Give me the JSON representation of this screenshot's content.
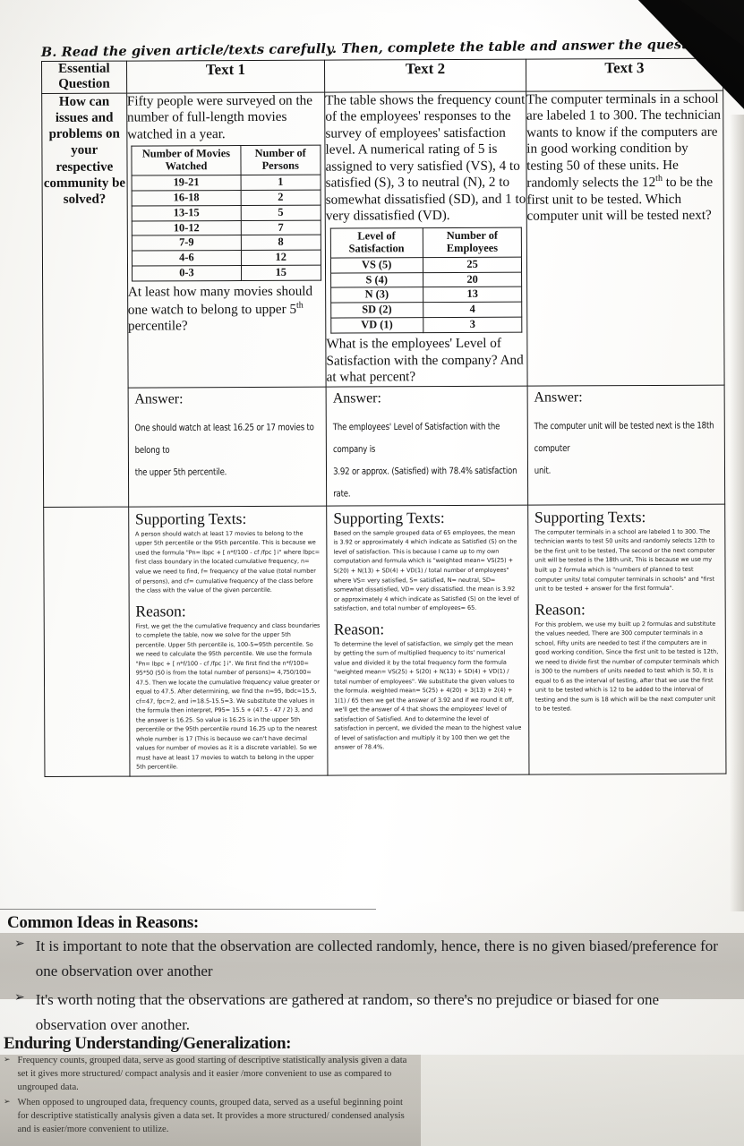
{
  "instruction": "B. Read the given article/texts carefully. Then, complete the table and answer the questions that follow.",
  "headers": {
    "essential_question": "Essential Question",
    "text1": "Text 1",
    "text2": "Text 2",
    "text3": "Text 3"
  },
  "essential_question_text": "How can issues and problems on your respective community be solved?",
  "text1": {
    "intro": "Fifty people were surveyed on the number of full-length movies watched in a year.",
    "table": {
      "col1": "Number of Movies Watched",
      "col2": "Number of Persons",
      "rows": [
        {
          "c1": "19-21",
          "c2": "1"
        },
        {
          "c1": "16-18",
          "c2": "2"
        },
        {
          "c1": "13-15",
          "c2": "5"
        },
        {
          "c1": "10-12",
          "c2": "7"
        },
        {
          "c1": "7-9",
          "c2": "8"
        },
        {
          "c1": "4-6",
          "c2": "12"
        },
        {
          "c1": "0-3",
          "c2": "15"
        }
      ]
    },
    "question_a": "At least how many movies should one watch to belong to upper 5",
    "question_sup": "th",
    "question_b": " percentile?",
    "answer_label": "Answer:",
    "answer_line1": "One should watch at least 16.25 or 17 movies to belong to",
    "answer_line2": "the upper 5th percentile.",
    "supporting_title": "Supporting Texts:",
    "supporting_text": "A person should watch at least 17 movies to belong to the upper 5th percentile or the 95th percentile. This is because we used the formula \"Pn= lbpc + [ n*f/100 - cf /fpc ] i\" where lbpc= first class boundary in the located cumulative frequency, n= value we need to find, f= frequency of the value (total number of persons), and cf= cumulative frequency of the class before the class with the value of the given percentile.",
    "reason_title": "Reason:",
    "reason_text": "First, we get the the cumulative frequency and class boundaries to complete the table, now we solve for the upper 5th percentile. Upper 5th percentile is, 100-5=95th percentile. So we need to calculate the 95th percentile. We use the formula \"Pn= lbpc + [ n*f/100 - cf /fpc ] i\". We first find the n*f/100= 95*50 (50 is from the total number of persons)= 4,750/100= 47.5. Then we locate the cumulative frequency value greater or equal to 47.5. After determining, we find the n=95, lbdc=15.5, cf=47, fpc=2, and i=18.5-15.5=3. We substitute the values in the formula then interpret, P95= 15.5 + (47.5 - 47 / 2) 3, and the answer is 16.25. So value is 16.25 is in the upper 5th percentile or the 95th percentile round 16.25 up to the nearest whole number is 17 (This is because we can't have decimal values for number of movies as it is a discrete variable). So we must have at least 17 movies to watch to belong in the upper 5th percentile."
  },
  "text2": {
    "intro": "The table shows the frequency count of the employees' responses to the survey of employees' satisfaction level. A numerical rating of 5 is assigned to very satisfied (VS), 4 to satisfied (S), 3 to neutral (N), 2 to somewhat dissatisfied (SD), and 1 to very dissatisfied (VD).",
    "table": {
      "col1": "Level of Satisfaction",
      "col2": "Number of Employees",
      "rows": [
        {
          "c1": "VS (5)",
          "c2": "25"
        },
        {
          "c1": "S (4)",
          "c2": "20"
        },
        {
          "c1": "N (3)",
          "c2": "13"
        },
        {
          "c1": "SD (2)",
          "c2": "4"
        },
        {
          "c1": "VD (1)",
          "c2": "3"
        }
      ]
    },
    "question": "What is the employees' Level of Satisfaction with the company? And at what percent?",
    "answer_label": "Answer:",
    "answer_line1": "The employees' Level of Satisfaction with the company is",
    "answer_line2": "3.92 or approx. (Satisfied) with 78.4% satisfaction rate.",
    "supporting_title": "Supporting Texts:",
    "supporting_text": "Based on the sample grouped data of 65 employees, the mean is 3.92 or approximately 4 which indicate as Satisfied (S) on the level of satisfaction. This is because I came up to my own computation and formula which is \"weighted mean= VS(25) + S(20) + N(13) + SD(4) + VD(1) / total number of employees\" where VS= very satisfied, S= satisfied, N= neutral, SD= somewhat dissatisfied, VD= very dissatisfied. the mean is 3.92 or approximately 4 which indicate as Satisfied (S) on the level of satisfaction, and total number of employees= 65.",
    "reason_title": "Reason:",
    "reason_text": "To determine the level of satisfaction, we simply get the mean by getting the sum of multiplied frequency to its' numerical value and divided it by the total frequency form the formula \"weighted mean= VS(25) + S(20) + N(13) + SD(4) + VD(1) / total number of employees\". We substitute the given values to the formula. weighted mean= 5(25) + 4(20) + 3(13) + 2(4) + 1(1) / 65 then we get the answer of 3.92 and if we round it off, we'll get the answer of 4 that shows the employees' level of satisfaction of Satisfied. And to determine the level of satisfaction in percent, we divided the mean to the highest value of level of satisfaction and multiply it by 100 then we get the answer of 78.4%."
  },
  "text3": {
    "intro_a": "The computer terminals in a school are labeled 1 to 300. The technician wants to know if the computers are in good working condition by testing 50 of these units. He randomly selects the 12",
    "intro_sup": "th",
    "intro_b": " to be the first unit to be tested. Which computer unit will be tested next?",
    "answer_label": "Answer:",
    "answer_line1": "The computer unit will be tested next is the 18th computer",
    "answer_line2": "unit.",
    "supporting_title": "Supporting Texts:",
    "supporting_text": "The computer terminals in a school are labeled 1 to 300. The technician wants to test 50 units and randomly selects 12th to be the first unit to be tested, The second or the next computer unit will be tested is the 18th unit, This is because we use my built up 2 formula which is \"numbers of planned to test computer units/ total computer terminals in schools\" and \"first unit to be tested + answer for the first formula\".",
    "reason_title": "Reason:",
    "reason_text": "For this problem, we use my built up 2 formulas and substitute the values needed, There are 300 computer terminals in a school, Fifty units are needed to test if the computers are in good working condition, Since the first unit to be tested is 12th, we need to divide first the number of computer terminals which is 300 to the numbers of units needed to test which is 50, It is equal to 6 as the interval of testing, after that we use the first unit to be tested which is 12 to be added to the interval of testing and the sum is 18 which will be the next computer unit to be tested."
  },
  "common_ideas": {
    "title": "Common Ideas in Reasons:",
    "bullet_glyph": "➢",
    "items": [
      "It is important to note that the observation are collected randomly, hence, there is no given biased/preference for one observation over another",
      "It's worth noting that the observations are gathered at random, so there's no prejudice or biased for one observation over another."
    ]
  },
  "enduring": {
    "title": "Enduring Understanding/Generalization:",
    "bullet_glyph": "➢",
    "items": [
      "Frequency counts, grouped data, serve as good starting of descriptive statistically analysis given a data set it gives more structured/ compact analysis and it easier /more convenient to use as compared to ungrouped data.",
      "When opposed to ungrouped data, frequency counts, grouped data, served as a useful beginning point for descriptive statistically analysis given a data set. It provides a more structured/ condensed analysis and is easier/more convenient to utilize."
    ]
  }
}
